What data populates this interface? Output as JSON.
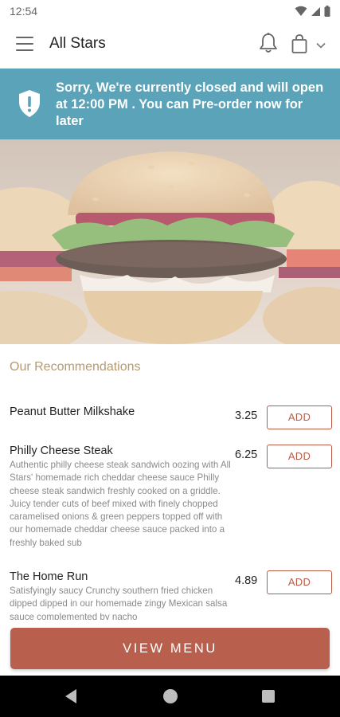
{
  "status_bar": {
    "time": "12:54"
  },
  "app_bar": {
    "title": "All Stars"
  },
  "banner": {
    "message": "Sorry, We're currently closed and will open at 12:00 PM . You can Pre-order now for later"
  },
  "recommendations": {
    "title": "Our Recommendations",
    "items": [
      {
        "name": "Peanut Butter Milkshake",
        "description": "",
        "price": "3.25",
        "add_label": "ADD"
      },
      {
        "name": "Philly Cheese Steak",
        "description": "Authentic philly cheese steak sandwich oozing with All Stars' homemade rich cheddar cheese sauce  Philly cheese steak sandwich freshly cooked on a griddle. Juicy tender cuts of beef mixed with finely chopped caramelised onions & green peppers topped off with our homemade cheddar cheese sauce packed into a freshly baked sub",
        "price": "6.25",
        "add_label": "ADD"
      },
      {
        "name": "The Home Run",
        "description": "Satisfyingly saucy  Crunchy southern fried chicken dipped dipped in our homemade zingy Mexican salsa sauce complemented by nacho",
        "price": "4.89",
        "add_label": "ADD"
      }
    ]
  },
  "view_menu_label": "VIEW MENU",
  "colors": {
    "banner": "#5aa3b8",
    "accent": "#b8604d",
    "section_title": "#b59a72"
  }
}
